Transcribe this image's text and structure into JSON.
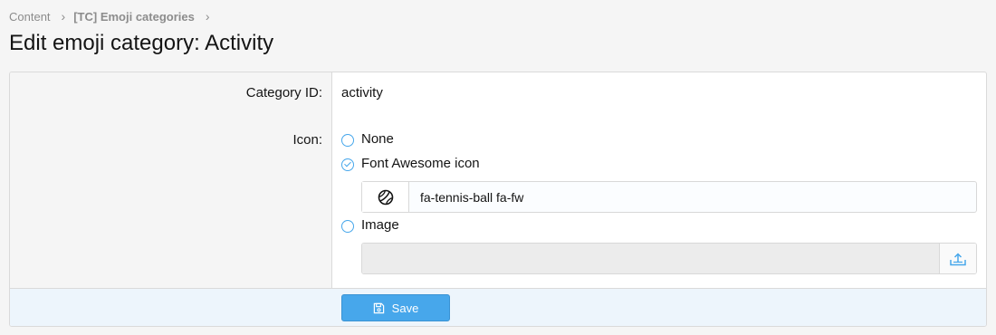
{
  "breadcrumb": {
    "items": [
      {
        "label": "Content"
      },
      {
        "label": "[TC] Emoji categories"
      }
    ]
  },
  "page": {
    "title": "Edit emoji category: Activity"
  },
  "form": {
    "category_id": {
      "label": "Category ID:",
      "value": "activity"
    },
    "icon": {
      "label": "Icon:",
      "options": [
        {
          "label": "None",
          "checked": false
        },
        {
          "label": "Font Awesome icon",
          "checked": true
        },
        {
          "label": "Image",
          "checked": false
        }
      ],
      "fa_value": "fa-tennis-ball fa-fw",
      "fa_preview_icon": "tennis-ball-icon",
      "image_value": "",
      "upload_icon": "upload-icon"
    },
    "save_label": "Save",
    "save_icon": "save-icon"
  },
  "colors": {
    "accent": "#47a7eb",
    "submit_row_bg": "#edf5fc",
    "label_col_bg": "#f5f5f5"
  }
}
